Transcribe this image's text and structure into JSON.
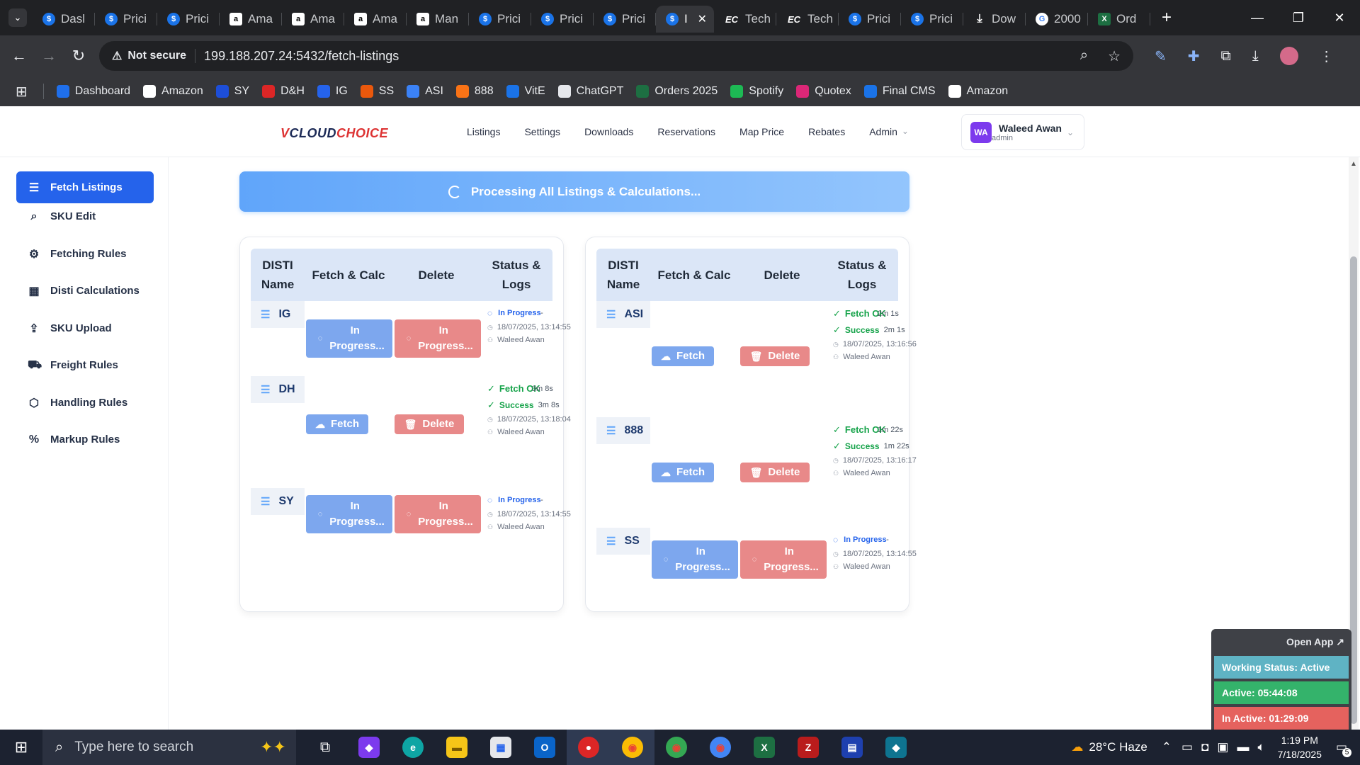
{
  "browser": {
    "tabs": [
      {
        "label": "Dasl",
        "icon": "s"
      },
      {
        "label": "Prici",
        "icon": "s"
      },
      {
        "label": "Prici",
        "icon": "s"
      },
      {
        "label": "Ama",
        "icon": "a"
      },
      {
        "label": "Ama",
        "icon": "a"
      },
      {
        "label": "Ama",
        "icon": "a"
      },
      {
        "label": "Man",
        "icon": "a"
      },
      {
        "label": "Prici",
        "icon": "s"
      },
      {
        "label": "Prici",
        "icon": "s"
      },
      {
        "label": "Prici",
        "icon": "s"
      },
      {
        "label": "I",
        "icon": "s"
      },
      {
        "label": "Tech",
        "icon": "ec"
      },
      {
        "label": "Tech",
        "icon": "ec"
      },
      {
        "label": "Prici",
        "icon": "s"
      },
      {
        "label": "Prici",
        "icon": "s"
      },
      {
        "label": "Dow",
        "icon": "dl"
      },
      {
        "label": "2000",
        "icon": "g"
      },
      {
        "label": "Ord",
        "icon": "x"
      }
    ],
    "not_secure": "Not secure",
    "url": "199.188.207.24:5432/fetch-listings",
    "bookmarks": [
      {
        "label": "Dashboard",
        "color": "#1f6feb"
      },
      {
        "label": "Amazon",
        "color": "#ffffff"
      },
      {
        "label": "SY",
        "color": "#1d4ed8"
      },
      {
        "label": "D&H",
        "color": "#dc2626"
      },
      {
        "label": "IG",
        "color": "#2563eb"
      },
      {
        "label": "SS",
        "color": "#ea580c"
      },
      {
        "label": "ASI",
        "color": "#3b82f6"
      },
      {
        "label": "888",
        "color": "#f97316"
      },
      {
        "label": "VitE",
        "color": "#1a73e8"
      },
      {
        "label": "ChatGPT",
        "color": "#e5e7eb"
      },
      {
        "label": "Orders 2025",
        "color": "#1d6f42"
      },
      {
        "label": "Spotify",
        "color": "#1db954"
      },
      {
        "label": "Quotex",
        "color": "#db2777"
      },
      {
        "label": "Final CMS",
        "color": "#1a73e8"
      },
      {
        "label": "Amazon",
        "color": "#ffffff"
      }
    ]
  },
  "app": {
    "logo_v": "V",
    "logo_cloud": "CLOUD",
    "logo_choice": "CHOICE",
    "nav": [
      "Listings",
      "Settings",
      "Downloads",
      "Reservations",
      "Map Price",
      "Rebates",
      "Admin"
    ],
    "user": {
      "initials": "WA",
      "name": "Waleed Awan",
      "role": "admin"
    },
    "sidebar": [
      {
        "label": "Fetch Listings",
        "icon": "list-icon",
        "glyph": "☰"
      },
      {
        "label": "SKU Edit",
        "icon": "search-icon",
        "glyph": "⌕"
      },
      {
        "label": "Fetching Rules",
        "icon": "gear-icon",
        "glyph": "⚙"
      },
      {
        "label": "Disti Calculations",
        "icon": "calculator-icon",
        "glyph": "▦"
      },
      {
        "label": "SKU Upload",
        "icon": "upload-icon",
        "glyph": "⇪"
      },
      {
        "label": "Freight Rules",
        "icon": "truck-icon",
        "glyph": "⛟"
      },
      {
        "label": "Handling Rules",
        "icon": "box-icon",
        "glyph": "⬡"
      },
      {
        "label": "Markup Rules",
        "icon": "percent-icon",
        "glyph": "%"
      }
    ],
    "banner": "Processing All Listings & Calculations...",
    "table_headers": [
      "DISTI Name",
      "Fetch & Calc",
      "Delete",
      "Status & Logs"
    ],
    "left_rows": [
      {
        "name": "IG",
        "fetch": "In Progress...",
        "delete": "In Progress...",
        "status": "In Progress",
        "dash": "-",
        "date": "18/07/2025, 13:14:55",
        "user": "Waleed Awan"
      },
      {
        "name": "DH",
        "fetch": "Fetch",
        "delete": "Delete",
        "ok": "Fetch OK",
        "ok_dur": "3m 8s",
        "status": "Success",
        "dur": "3m 8s",
        "date": "18/07/2025, 13:18:04",
        "user": "Waleed Awan"
      },
      {
        "name": "SY",
        "fetch": "In Progress...",
        "delete": "In Progress...",
        "status": "In Progress",
        "dash": "-",
        "date": "18/07/2025, 13:14:55",
        "user": "Waleed Awan"
      }
    ],
    "right_rows": [
      {
        "name": "ASI",
        "fetch": "Fetch",
        "delete": "Delete",
        "ok": "Fetch OK",
        "ok_dur": "2m 1s",
        "status": "Success",
        "dur": "2m 1s",
        "date": "18/07/2025, 13:16:56",
        "user": "Waleed Awan"
      },
      {
        "name": "888",
        "fetch": "Fetch",
        "delete": "Delete",
        "ok": "Fetch OK",
        "ok_dur": "1m 22s",
        "status": "Success",
        "dur": "1m 22s",
        "date": "18/07/2025, 13:16:17",
        "user": "Waleed Awan"
      },
      {
        "name": "SS",
        "fetch": "In Progress...",
        "delete": "In Progress...",
        "status": "In Progress",
        "dash": "-",
        "date": "18/07/2025, 13:14:55",
        "user": "Waleed Awan"
      }
    ]
  },
  "widget": {
    "open": "Open App ↗",
    "working": "Working Status: Active",
    "active": "Active: 05:44:08",
    "inactive": "In Active: 01:29:09",
    "colors": {
      "working": "#5fb3c4",
      "active": "#34b36b",
      "inactive": "#e5625e"
    }
  },
  "taskbar": {
    "search": "Type here to search",
    "weather": "28°C  Haze",
    "time": "1:19 PM",
    "date": "7/18/2025",
    "notif": "5"
  }
}
